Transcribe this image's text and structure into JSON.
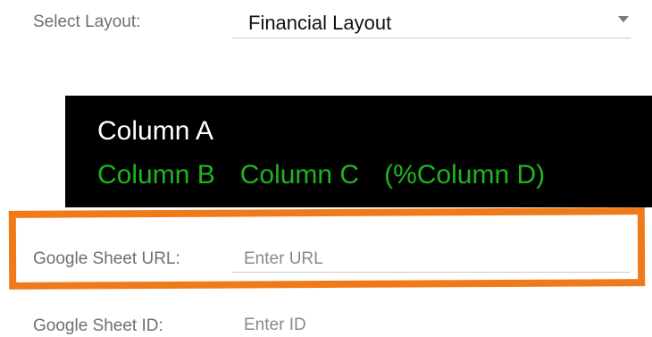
{
  "layout": {
    "label": "Select Layout:",
    "selected": "Financial Layout"
  },
  "preview": {
    "column_a": "Column A",
    "column_b": "Column B",
    "column_c": "Column C",
    "column_d": "(%Column D)",
    "colors": {
      "background": "#000000",
      "primary_text": "#ffffff",
      "secondary_text": "#1fb41f"
    }
  },
  "sheet_url": {
    "label": "Google Sheet URL:",
    "placeholder": "Enter URL"
  },
  "sheet_id": {
    "label": "Google Sheet ID:",
    "placeholder": "Enter ID"
  },
  "highlight": {
    "color": "#f07a1a"
  }
}
